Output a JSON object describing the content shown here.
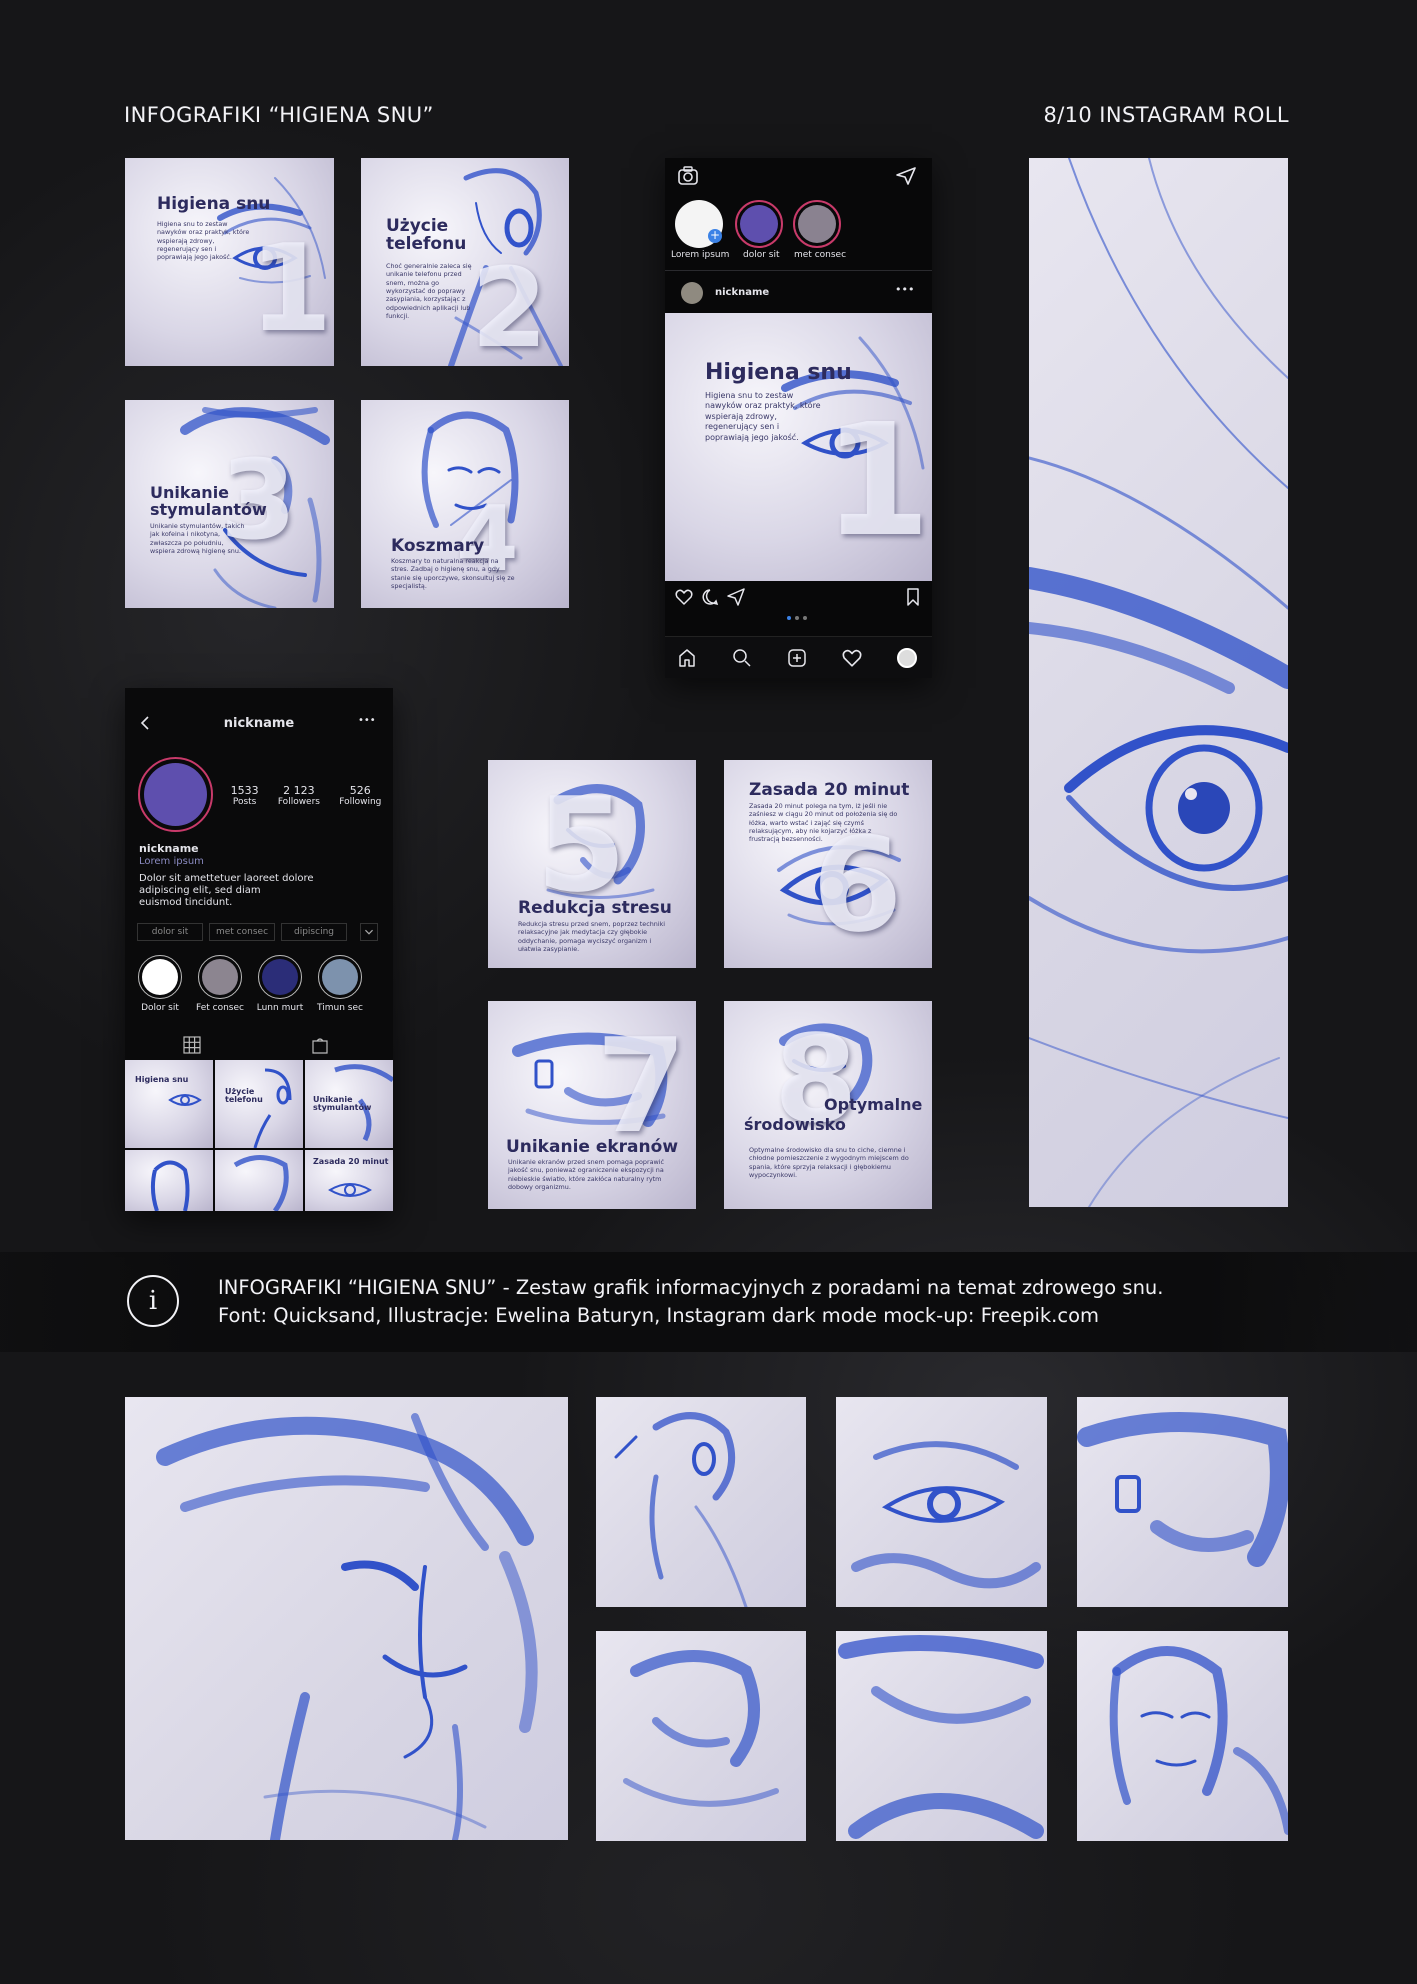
{
  "header": {
    "left": "INFOGRAFIKI “HIGIENA SNU”",
    "right": "8/10 INSTAGRAM ROLL"
  },
  "tiles": {
    "t1": {
      "title": "Higiena snu",
      "text": "Higiena snu to zestaw nawyków oraz praktyk, które wspierają zdrowy, regenerujący sen i poprawiają jego jakość.",
      "number": "1"
    },
    "t2": {
      "title": "Użycie telefonu",
      "text": "Choć generalnie zaleca się unikanie telefonu przed snem, można go wykorzystać do poprawy zasypiania, korzystając z odpowiednich aplikacji lub funkcji.",
      "number": "2"
    },
    "t3": {
      "title": "Unikanie stymulantów",
      "text": "Unikanie stymulantów, takich jak kofeina i nikotyna, zwłaszcza po południu, wspiera zdrową higienę snu.",
      "number": "3"
    },
    "t4": {
      "title": "Koszmary",
      "text": "Koszmary to naturalna reakcja na stres. Zadbaj o higienę snu, a gdy stanie się uporczywe, skonsultuj się ze specjalistą.",
      "number": "4"
    },
    "t5": {
      "title": "Redukcja stresu",
      "text": "Redukcja stresu przed snem, poprzez techniki relaksacyjne jak medytacja czy głębokie oddychanie, pomaga wyciszyć organizm i ułatwia zasypianie.",
      "number": "5"
    },
    "t6": {
      "title": "Zasada 20 minut",
      "text": "Zasada 20 minut polega na tym, iż jeśli nie zaśniesz w ciągu 20 minut od położenia się do łóżka, warto wstać i zająć się czymś relaksującym, aby nie kojarzyć łóżka z frustracją bezsenności.",
      "number": "6"
    },
    "t7": {
      "title": "Unikanie ekranów",
      "text": "Unikanie ekranów przed snem pomaga poprawić jakość snu, ponieważ ograniczenie ekspozycji na niebieskie światło, które zakłóca naturalny rytm dobowy organizmu.",
      "number": "7"
    },
    "t8": {
      "title_line1": "Optymalne",
      "title_line2": "środowisko",
      "text": "Optymalne środowisko dla snu to ciche, ciemne i chłodne pomieszczenie z wygodnym miejscem do spania, które sprzyja relaksacji i głębokiemu wypoczynkowi.",
      "number": "8"
    }
  },
  "phone_feed": {
    "stories": [
      {
        "label": "Lorem ipsum",
        "color": "#f4f4f4"
      },
      {
        "label": "dolor sit",
        "color": "#5e4fae"
      },
      {
        "label": "met consec",
        "color": "#8a8290"
      }
    ],
    "post_user": "nickname",
    "more": "•••",
    "post": {
      "title": "Higiena snu",
      "text": "Higiena snu to zestaw nawyków oraz praktyk, które wspierają zdrowy, regenerujący sen i poprawiają jego jakość.",
      "number": "1"
    }
  },
  "phone_profile": {
    "username": "nickname",
    "more": "•••",
    "stats": [
      {
        "value": "1533",
        "label": "Posts"
      },
      {
        "value": "2 123",
        "label": "Followers"
      },
      {
        "value": "526",
        "label": "Following"
      }
    ],
    "name": "nickname",
    "subtitle": "Lorem ipsum",
    "bio_line1": "Dolor sit amettetuer laoreet dolore",
    "bio_line2": "adipiscing elit, sed diam",
    "bio_line3": "euismod tincidunt.",
    "buttons": [
      "dolor sit",
      "met consec",
      "dipiscing"
    ],
    "highlights": [
      {
        "label": "Dolor sit",
        "color": "#ffffff"
      },
      {
        "label": "Fet consec",
        "color": "#8c8590"
      },
      {
        "label": "Lunn murt",
        "color": "#2b2d78"
      },
      {
        "label": "Timun sec",
        "color": "#7d92ad"
      }
    ],
    "grid": [
      {
        "title": "Higiena snu"
      },
      {
        "title": "Użycie telefonu"
      },
      {
        "title": "Unikanie stymulantów"
      },
      {
        "title": ""
      },
      {
        "title": ""
      },
      {
        "title": "Zasada 20 minut"
      }
    ]
  },
  "info": {
    "icon_glyph": "i",
    "line1": "INFOGRAFIKI “HIGIENA SNU” - Zestaw grafik informacyjnych z poradami na temat zdrowego snu.",
    "line2": "Font: Quicksand, Illustracje: Ewelina Baturyn, Instagram dark mode mock-up: Freepik.com"
  },
  "colors": {
    "background": "#161618",
    "ink_blue": "#2f4fc4",
    "title_navy": "#2d2b5e",
    "paper": "#dcdae8"
  },
  "icons": [
    "camera-icon",
    "send-icon",
    "heart-icon",
    "comment-icon",
    "share-icon",
    "bookmark-icon",
    "home-icon",
    "search-icon",
    "add-icon",
    "activity-icon",
    "profile-icon",
    "back-icon",
    "grid-icon",
    "tagged-icon",
    "chevron-down-icon",
    "info-icon"
  ]
}
